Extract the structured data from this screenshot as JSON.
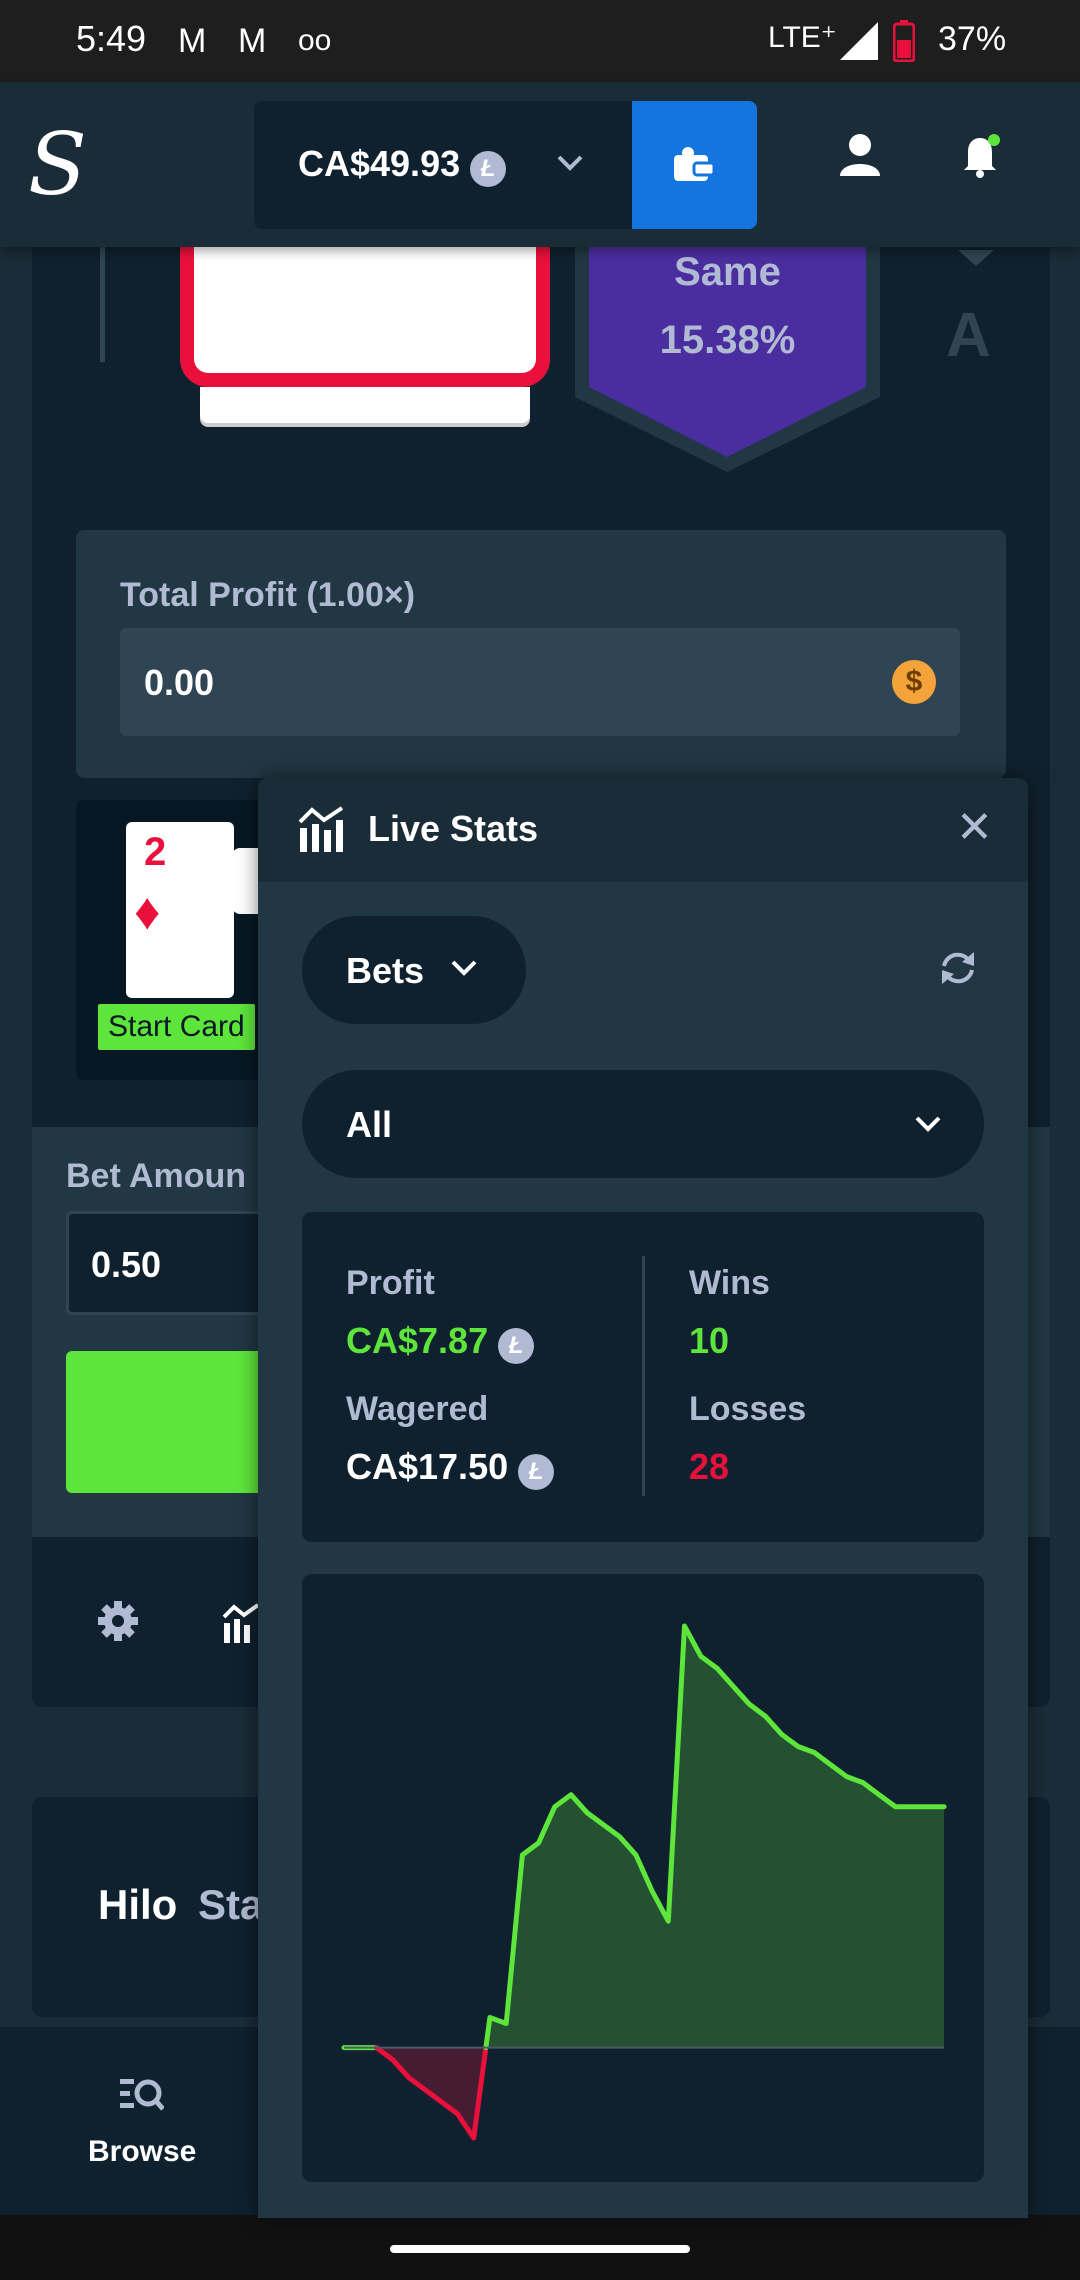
{
  "status_bar": {
    "time": "5:49",
    "network": "LTE⁺",
    "battery": "37%"
  },
  "header": {
    "logo": "S",
    "balance": "CA$49.93",
    "balance_coin": "Ł"
  },
  "game": {
    "same_label": "Same",
    "same_percent": "15.38%",
    "next_rank": "A",
    "total_profit_label": "Total Profit (1.00×)",
    "total_profit_value": "0.00",
    "profit_currency_symbol": "$",
    "history_card_rank": "2",
    "history_card_suit": "♦",
    "start_card_label": "Start Card",
    "bet_amount_label": "Bet Amoun",
    "bet_amount_value": "0.50",
    "game_name": "Hilo",
    "game_provider_partial": "Sta"
  },
  "bottom_nav": {
    "browse_label": "Browse"
  },
  "live_stats": {
    "title": "Live Stats",
    "filter_label": "Bets",
    "scope_label": "All",
    "profit_label": "Profit",
    "profit_value": "CA$7.87",
    "wagered_label": "Wagered",
    "wagered_value": "CA$17.50",
    "wins_label": "Wins",
    "wins_value": "10",
    "losses_label": "Losses",
    "losses_value": "28",
    "coin": "Ł"
  },
  "chart_data": {
    "type": "area",
    "title": "",
    "xlabel": "",
    "ylabel": "",
    "grid": false,
    "positive_color": "#5ee53b",
    "negative_color": "#e9113c",
    "ylim": [
      -0.8,
      3.6
    ],
    "x": [
      0,
      1,
      2,
      3,
      4,
      5,
      6,
      7,
      8,
      9,
      10,
      11,
      12,
      13,
      14,
      15,
      16,
      17,
      18,
      19,
      20,
      21,
      22,
      23,
      24,
      25,
      26,
      27,
      28,
      29,
      30,
      31,
      32,
      33,
      34,
      35,
      36,
      37
    ],
    "y": [
      0,
      0,
      0,
      -0.1,
      -0.25,
      -0.35,
      -0.45,
      -0.55,
      -0.75,
      0.25,
      0.2,
      1.6,
      1.7,
      2.0,
      2.1,
      1.95,
      1.85,
      1.75,
      1.6,
      1.3,
      1.05,
      3.5,
      3.25,
      3.15,
      3.0,
      2.85,
      2.75,
      2.6,
      2.5,
      2.45,
      2.35,
      2.25,
      2.2,
      2.1,
      2.0,
      2.0,
      2.0,
      2.0
    ]
  }
}
